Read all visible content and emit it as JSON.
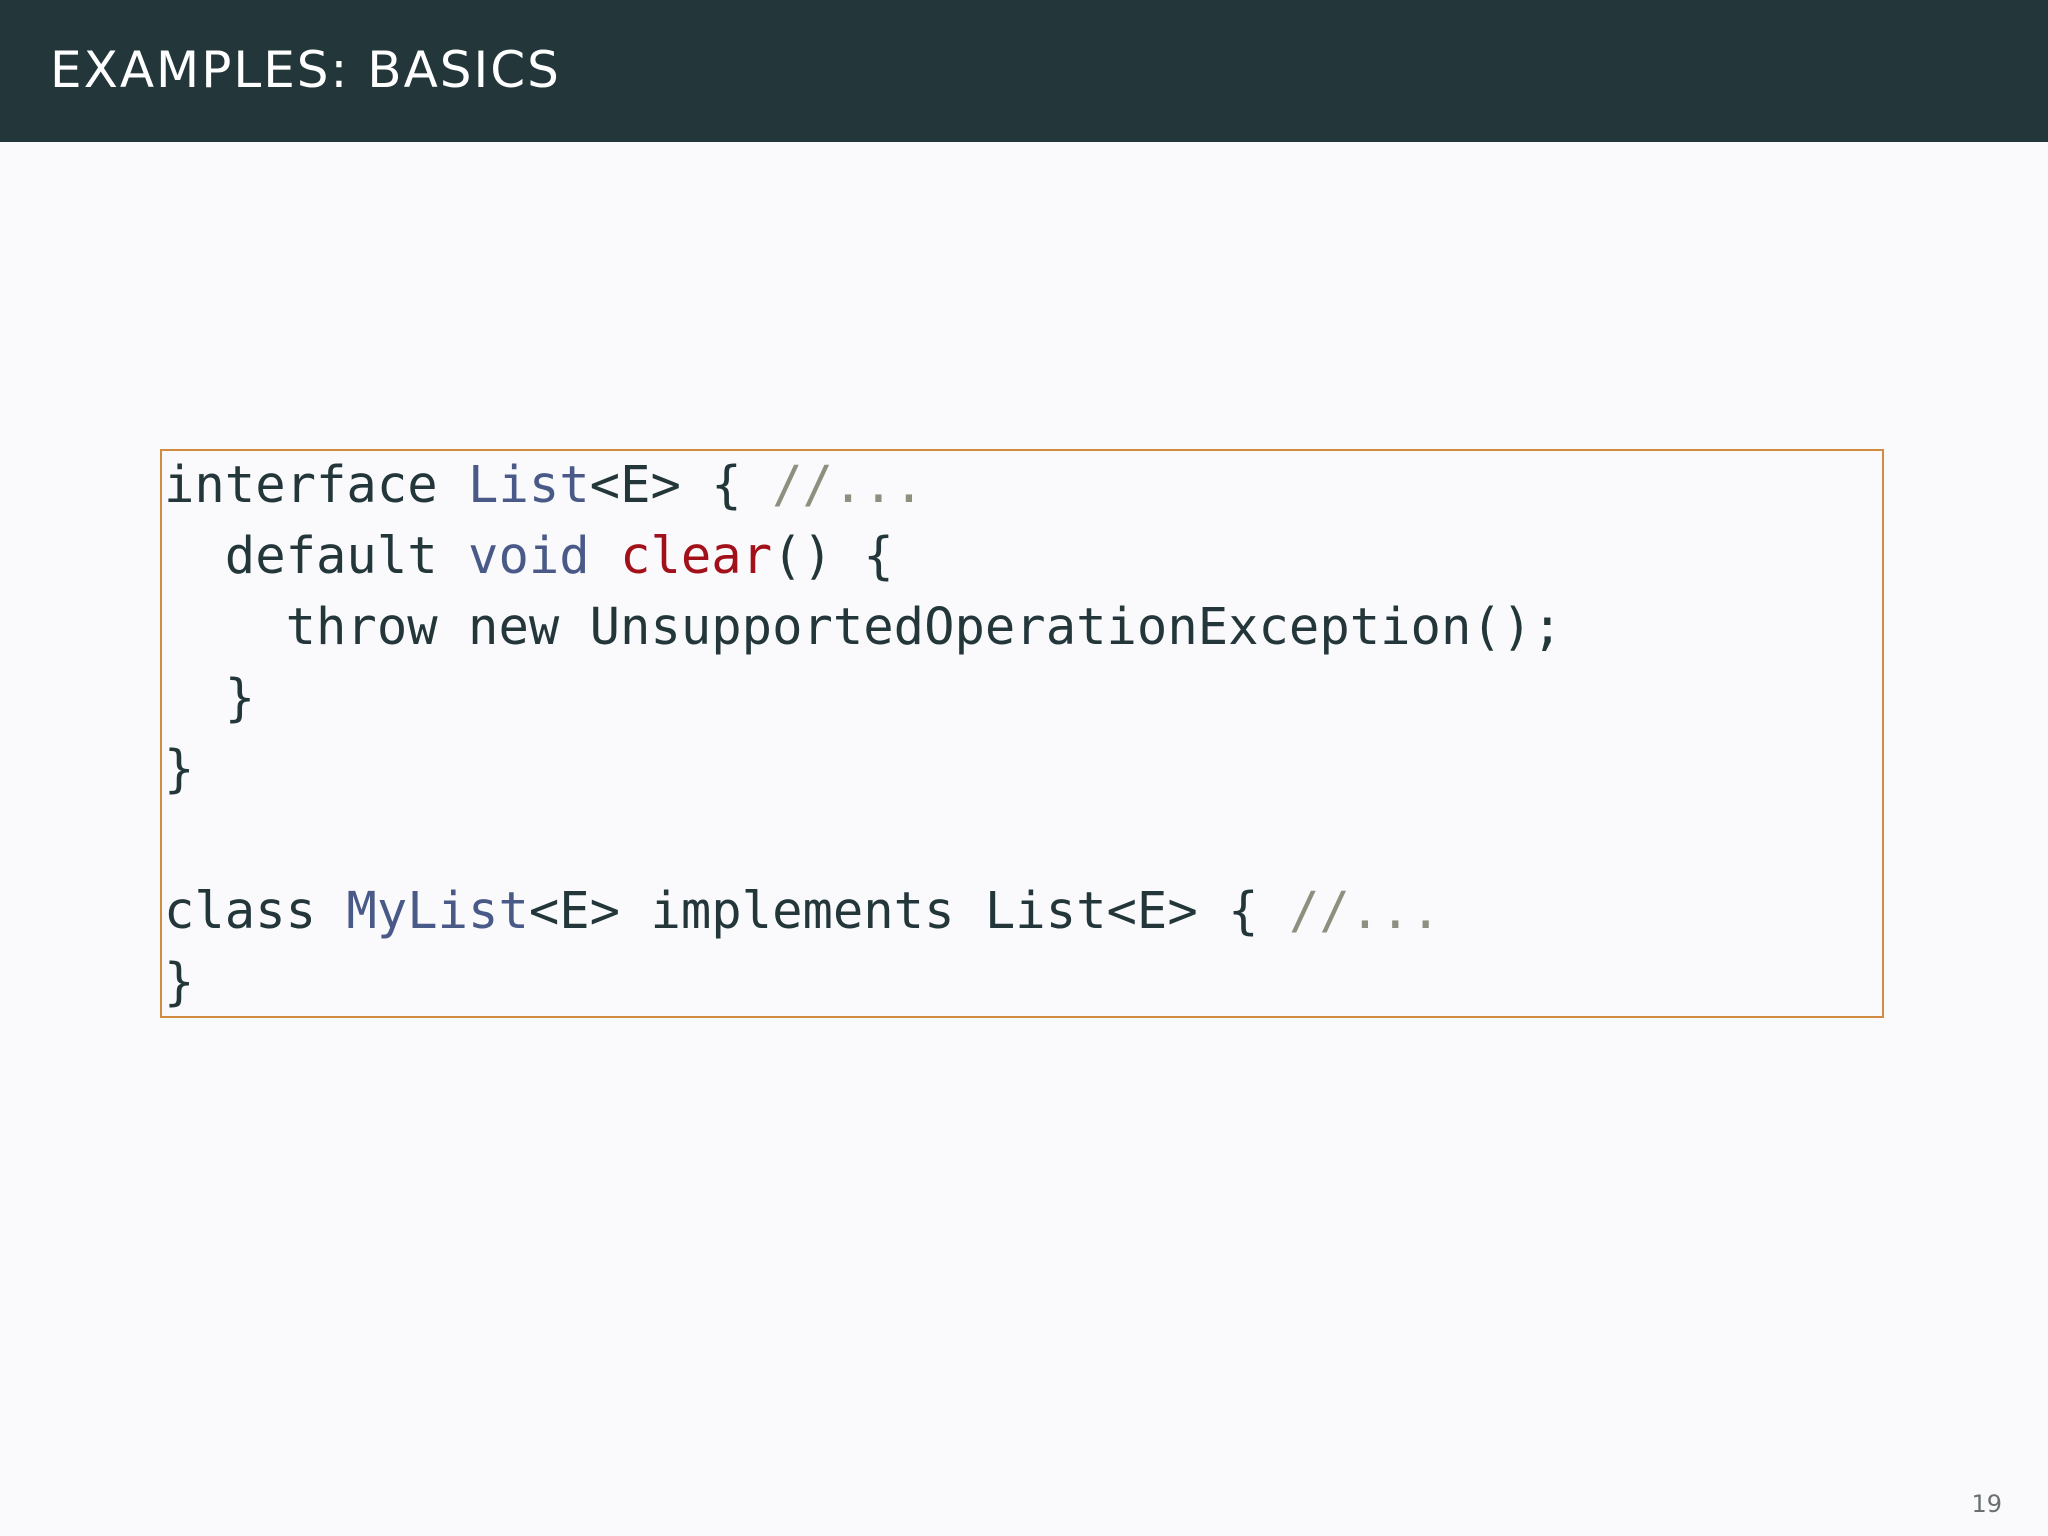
{
  "slide": {
    "title": "EXAMPLES: BASICS",
    "page_number": "19"
  },
  "code": {
    "lines": [
      [
        {
          "t": "interface "
        },
        {
          "t": "List",
          "c": "type"
        },
        {
          "t": "<E> { "
        },
        {
          "t": "//...",
          "c": "comment"
        }
      ],
      [
        {
          "t": "  default "
        },
        {
          "t": "void",
          "c": "type"
        },
        {
          "t": " "
        },
        {
          "t": "clear",
          "c": "func"
        },
        {
          "t": "() {"
        }
      ],
      [
        {
          "t": "    throw new UnsupportedOperationException();"
        }
      ],
      [
        {
          "t": "  }"
        }
      ],
      [
        {
          "t": "}"
        }
      ],
      [],
      [
        {
          "t": "class "
        },
        {
          "t": "MyList",
          "c": "type"
        },
        {
          "t": "<E> implements List<E> { "
        },
        {
          "t": "//...",
          "c": "comment"
        }
      ],
      [
        {
          "t": "}"
        }
      ]
    ]
  }
}
